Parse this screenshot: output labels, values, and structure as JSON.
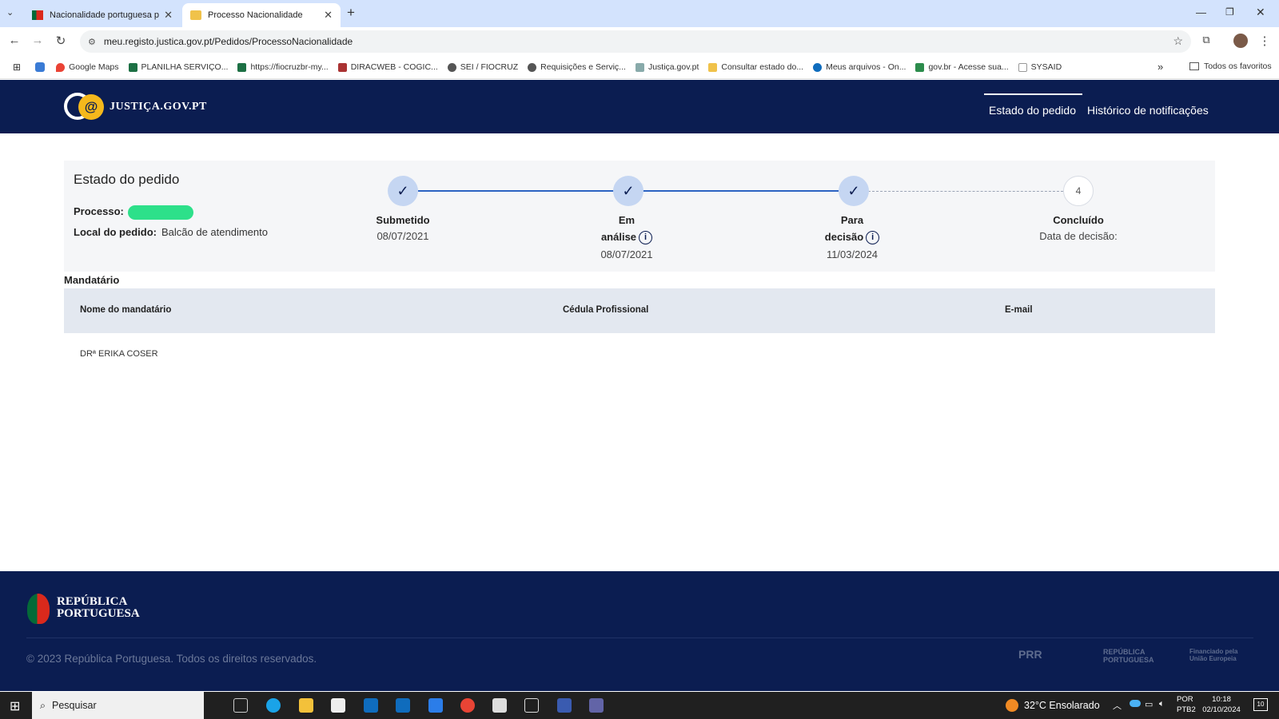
{
  "browser": {
    "tabs": [
      {
        "title": "Nacionalidade portuguesa pelo"
      },
      {
        "title": "Processo Nacionalidade"
      }
    ],
    "new_tab": "+",
    "address": "meu.registo.justica.gov.pt/Pedidos/ProcessoNacionalidade",
    "bookmarks": [
      "Google Maps",
      "PLANILHA SERVIÇO...",
      "https://fiocruzbr-my...",
      "DIRACWEB - COGIC...",
      "SEI / FIOCRUZ",
      "Requisições e Serviç...",
      "Justiça.gov.pt",
      "Consultar estado do...",
      "Meus arquivos - On...",
      "gov.br - Acesse sua...",
      "SYSAID"
    ],
    "bookmarks_more": "»",
    "all_favorites": "Todos os favoritos"
  },
  "site": {
    "logo_text": "JUSTIÇA.GOV.PT",
    "nav": [
      "Estado do pedido",
      "Histórico de notificações"
    ]
  },
  "status": {
    "title": "Estado do pedido",
    "processo_label": "Processo:",
    "local_label": "Local do pedido:",
    "local_value": "Balcão de atendimento",
    "steps": [
      {
        "label": "Submetido",
        "date": "08/07/2021"
      },
      {
        "label_1": "Em",
        "label_2": "análise",
        "date": "08/07/2021"
      },
      {
        "label_1": "Para",
        "label_2": "decisão",
        "date": "11/03/2024"
      },
      {
        "number": "4",
        "label": "Concluído",
        "date": "Data de decisão:"
      }
    ]
  },
  "mandatario": {
    "title": "Mandatário",
    "columns": [
      "Nome do mandatário",
      "Cédula Profissional",
      "E-mail"
    ],
    "rows": [
      [
        "DRª ERIKA COSER",
        "",
        ""
      ]
    ]
  },
  "footer": {
    "republica_1": "REPÚBLICA",
    "republica_2": "PORTUGUESA",
    "copyright": "© 2023 República Portuguesa. Todos os direitos reservados.",
    "logos": [
      "PRR",
      "REPÚBLICA PORTUGUESA",
      "Financiado pela União Europeia"
    ]
  },
  "taskbar": {
    "search": "Pesquisar",
    "weather": "32°C  Ensolarado",
    "lang_1": "POR",
    "lang_2": "PTB2",
    "time": "10:18",
    "date": "02/10/2024",
    "notif": "10"
  },
  "colors": {
    "navy": "#0b1d51",
    "accent": "#2c63c2",
    "gold": "#f5b81c"
  }
}
